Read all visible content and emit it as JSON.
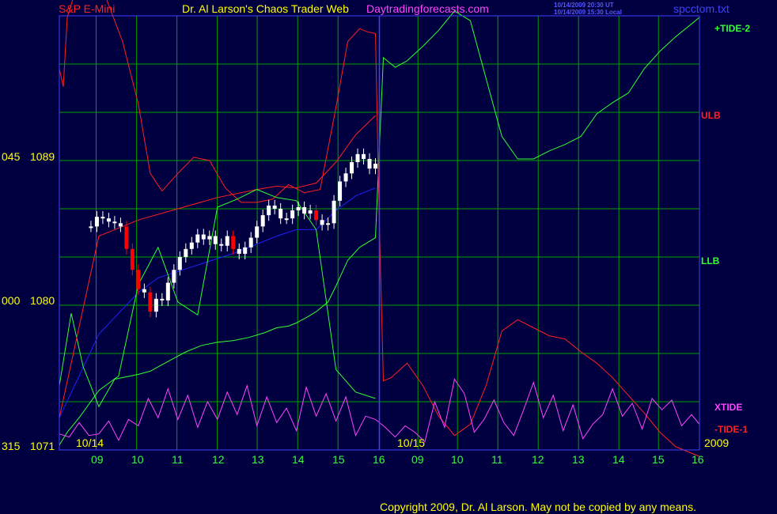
{
  "header": {
    "symbol": "S&P E-Mini",
    "title": "Dr. Al Larson's Chaos Trader Web",
    "site": "Daytradingforecasts.com",
    "time_utc": "10/14/2009 20:30 UT",
    "time_local": "10/14/2009 15:30 Local",
    "file": "spcctom.txt"
  },
  "footer": {
    "copyright": "Copyright 2009, Dr. Al Larson. May not be copied by any means."
  },
  "colors": {
    "background": "#000040",
    "grid": "#00a000",
    "frame": "#4040ff",
    "price": "#ffffff",
    "price_down": "#ff0000",
    "tide2": "#33ff33",
    "tide1": "#ff2020",
    "xtide": "#ff44ff",
    "moving_avg": "#2020ff",
    "date_text": "#ffff00",
    "hour_text": "#33ff33",
    "title_text": "#ffff00",
    "symbol_text": "#ff2020",
    "site_text": "#ff44ff",
    "file_text": "#4040ff"
  },
  "chart_data": {
    "type": "line",
    "title": "S&P E-Mini",
    "y_axis": {
      "labels": [
        {
          "code": "045",
          "value": 1089
        },
        {
          "code": "000",
          "value": 1080
        },
        {
          "code": "315",
          "value": 1071
        }
      ],
      "range": [
        1071,
        1098
      ]
    },
    "x_axis": {
      "hour_labels": [
        "09",
        "10",
        "11",
        "12",
        "13",
        "14",
        "15",
        "16",
        "09",
        "10",
        "11",
        "12",
        "13",
        "14",
        "15",
        "16"
      ],
      "date_labels": [
        "10/14",
        "10/15"
      ],
      "year": "2009",
      "divider_after_index": 7
    },
    "band_labels": [
      "+TIDE-2",
      "ULB",
      "LLB",
      "XTIDE",
      "-TIDE-1"
    ],
    "series": [
      {
        "name": "Price",
        "kind": "bars",
        "x": [
          8.8,
          8.95,
          9.1,
          9.25,
          9.4,
          9.55,
          9.7,
          9.85,
          10.0,
          10.15,
          10.3,
          10.45,
          10.6,
          10.75,
          10.9,
          11.05,
          11.2,
          11.35,
          11.5,
          11.65,
          11.8,
          11.95,
          12.1,
          12.25,
          12.4,
          12.55,
          12.7,
          12.85,
          13.0,
          13.15,
          13.3,
          13.45,
          13.6,
          13.75,
          13.9,
          14.05,
          14.2,
          14.35,
          14.5,
          14.65,
          14.8,
          14.95,
          15.1,
          15.25,
          15.4,
          15.55,
          15.7,
          15.85,
          16.0
        ],
        "close": [
          1084.9,
          1085.5,
          1085.4,
          1085.2,
          1085.1,
          1084.9,
          1083.5,
          1082.2,
          1081.0,
          1080.8,
          1079.6,
          1080.4,
          1080.3,
          1081.4,
          1082.2,
          1083.0,
          1083.5,
          1083.9,
          1084.4,
          1084.1,
          1084.3,
          1083.8,
          1083.7,
          1084.3,
          1083.5,
          1083.2,
          1083.6,
          1084.2,
          1084.9,
          1085.6,
          1086.2,
          1086.0,
          1085.4,
          1085.4,
          1085.9,
          1086.1,
          1085.7,
          1085.9,
          1085.3,
          1085.0,
          1085.1,
          1086.5,
          1087.7,
          1088.2,
          1088.9,
          1089.4,
          1089.1,
          1088.5,
          1088.8
        ]
      },
      {
        "name": "Moving average",
        "kind": "line",
        "x": [
          8.0,
          8.5,
          9.0,
          9.5,
          10.0,
          10.5,
          11.0,
          11.5,
          12.0,
          12.5,
          13.0,
          13.5,
          14.0,
          14.5,
          15.0,
          15.5,
          16.0
        ],
        "y": [
          1073,
          1075.6,
          1078.2,
          1079.5,
          1080.8,
          1081.7,
          1082.1,
          1082.5,
          1082.9,
          1083.3,
          1083.8,
          1084.3,
          1084.7,
          1084.7,
          1085.9,
          1086.8,
          1087.3
        ]
      },
      {
        "name": "+TIDE-2",
        "kind": "line",
        "x": [
          8.0,
          8.3,
          8.6,
          9.0,
          9.4,
          9.8,
          10.0,
          10.3,
          10.6,
          10.9,
          11.2,
          11.6,
          12.0,
          12.4,
          12.8,
          13.2,
          13.5,
          13.8,
          14.0,
          14.3,
          14.5,
          14.8,
          15.0,
          15.3,
          15.6,
          16.0,
          16.2,
          16.5,
          16.8,
          17.2,
          17.6,
          18.0,
          18.4,
          18.8,
          19.2,
          19.6,
          20.0,
          20.4,
          20.8,
          21.2,
          21.6,
          22.0,
          22.4,
          22.8,
          23.2,
          23.6,
          24.0,
          24.2
        ],
        "y": [
          1075.0,
          1079.5,
          1076.2,
          1073.7,
          1075.4,
          1075.6,
          1075.7,
          1075.9,
          1076.3,
          1076.7,
          1077.1,
          1077.5,
          1077.7,
          1077.8,
          1078.0,
          1078.3,
          1078.6,
          1078.7,
          1078.9,
          1079.3,
          1079.6,
          1080.2,
          1081.2,
          1082.8,
          1083.6,
          1084.2,
          1095.4,
          1094.8,
          1095.2,
          1096.1,
          1097.1,
          1098.3,
          1097.7,
          1094.1,
          1090.5,
          1089.1,
          1089.1,
          1089.6,
          1090.0,
          1090.5,
          1091.9,
          1092.6,
          1093.2,
          1094.7,
          1095.8,
          1096.7,
          1097.5,
          1097.9
        ]
      },
      {
        "name": "-TIDE-1",
        "kind": "line",
        "x": [
          8.0,
          8.1,
          8.2,
          8.4,
          8.8,
          9.2,
          9.6,
          10.0,
          10.3,
          10.6,
          11.0,
          11.4,
          11.8,
          12.2,
          12.6,
          13.0,
          13.4,
          13.8,
          14.2,
          14.6,
          15.0,
          15.3,
          15.6,
          15.8,
          16.0,
          16.1,
          16.2,
          16.4,
          16.8,
          17.2,
          17.6,
          18.0,
          18.4,
          18.8,
          19.2,
          19.6,
          20.0,
          20.4,
          20.8,
          21.2,
          21.6,
          22.0,
          22.4,
          22.8,
          23.2,
          23.6,
          24.0,
          24.2
        ],
        "y": [
          1094.7,
          1093.6,
          1097.9,
          1099.5,
          1100.0,
          1099.0,
          1096.4,
          1092.5,
          1088.2,
          1087.1,
          1088.2,
          1089.2,
          1089.0,
          1087.3,
          1086.4,
          1086.4,
          1086.6,
          1087.5,
          1087.0,
          1087.2,
          1092.3,
          1096.4,
          1097.2,
          1097.0,
          1096.9,
          1085.0,
          1075.3,
          1075.5,
          1076.4,
          1075.0,
          1073.1,
          1071.9,
          1072.6,
          1075.0,
          1078.4,
          1079.1,
          1078.6,
          1078.1,
          1077.9,
          1077.1,
          1076.4,
          1075.5,
          1074.4,
          1073.3,
          1072.1,
          1071.2,
          1070.8,
          1070.6
        ]
      },
      {
        "name": "ULB",
        "kind": "line",
        "x": [
          8.0,
          9.0,
          10.0,
          11.0,
          12.0,
          13.0,
          13.5,
          14.0,
          14.5,
          15.0,
          15.5,
          16.0
        ],
        "y": [
          1073.0,
          1084.3,
          1085.3,
          1086.0,
          1086.7,
          1087.2,
          1087.4,
          1087.3,
          1087.6,
          1088.9,
          1090.6,
          1091.8
        ]
      },
      {
        "name": "LLB",
        "kind": "line",
        "x": [
          8.0,
          8.2,
          8.5,
          9.0,
          9.5,
          10.0,
          10.5,
          11.0,
          11.5,
          12.0,
          12.5,
          13.0,
          13.5,
          14.0,
          14.5,
          15.0,
          15.5,
          16.0
        ],
        "y": [
          1071.3,
          1072.1,
          1073.0,
          1074.7,
          1075.6,
          1081.3,
          1083.6,
          1080.2,
          1079.4,
          1086.1,
          1086.6,
          1087.2,
          1086.7,
          1086.5,
          1084.7,
          1076.0,
          1074.6,
          1074.2
        ]
      },
      {
        "name": "XTIDE",
        "kind": "line",
        "x": [
          8.0,
          8.25,
          8.5,
          8.75,
          9.0,
          9.25,
          9.5,
          9.75,
          10.0,
          10.25,
          10.5,
          10.75,
          11.0,
          11.25,
          11.5,
          11.75,
          12.0,
          12.25,
          12.5,
          12.75,
          13.0,
          13.25,
          13.5,
          13.75,
          14.0,
          14.25,
          14.5,
          14.75,
          15.0,
          15.25,
          15.5,
          15.75,
          16.0,
          16.25,
          16.5,
          16.75,
          17.0,
          17.25,
          17.5,
          17.75,
          18.0,
          18.25,
          18.5,
          18.75,
          19.0,
          19.25,
          19.5,
          19.75,
          20.0,
          20.25,
          20.5,
          20.75,
          21.0,
          21.25,
          21.5,
          21.75,
          22.0,
          22.25,
          22.5,
          22.75,
          23.0,
          23.25,
          23.5,
          23.75,
          24.0,
          24.2
        ],
        "y": [
          1072.0,
          1071.8,
          1072.7,
          1071.9,
          1072.0,
          1072.8,
          1071.6,
          1072.9,
          1072.5,
          1074.2,
          1073.0,
          1074.8,
          1072.9,
          1074.4,
          1072.4,
          1074.0,
          1072.9,
          1074.6,
          1073.2,
          1075.0,
          1072.5,
          1074.3,
          1072.7,
          1073.6,
          1072.2,
          1074.9,
          1073.1,
          1074.5,
          1072.8,
          1074.3,
          1071.9,
          1073.1,
          1072.9,
          1072.4,
          1071.8,
          1072.5,
          1072.1,
          1071.5,
          1074.0,
          1072.4,
          1075.4,
          1074.5,
          1072.1,
          1072.9,
          1074.1,
          1072.7,
          1071.9,
          1073.5,
          1075.2,
          1073.0,
          1074.4,
          1072.2,
          1073.8,
          1071.7,
          1072.6,
          1073.2,
          1074.8,
          1073.1,
          1073.9,
          1072.3,
          1074.2,
          1073.5,
          1074.1,
          1072.5,
          1073.2,
          1072.6
        ]
      }
    ]
  }
}
